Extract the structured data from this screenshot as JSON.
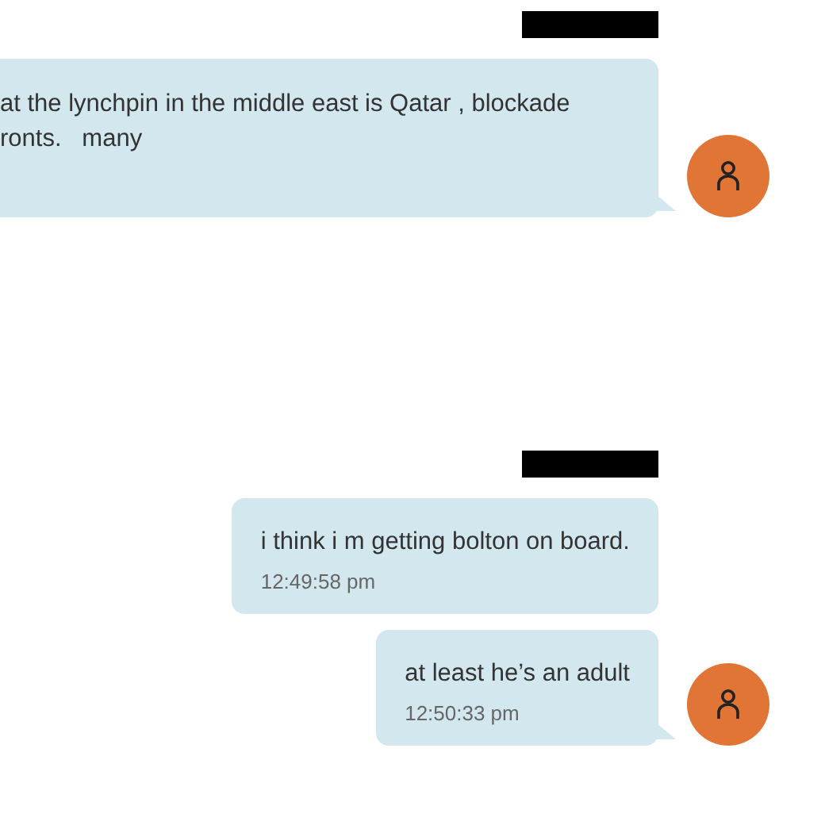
{
  "groups": [
    {
      "messages": [
        {
          "text": "at the lynchpin in the middle east is Qatar , blockade\nronts.   many",
          "show_avatar": true
        }
      ]
    },
    {
      "messages": [
        {
          "text": "i think i m getting bolton on board.",
          "time": "12:49:58 pm",
          "show_avatar": false
        },
        {
          "text": "at least he’s an adult",
          "time": "12:50:33 pm",
          "show_avatar": true
        }
      ]
    }
  ]
}
